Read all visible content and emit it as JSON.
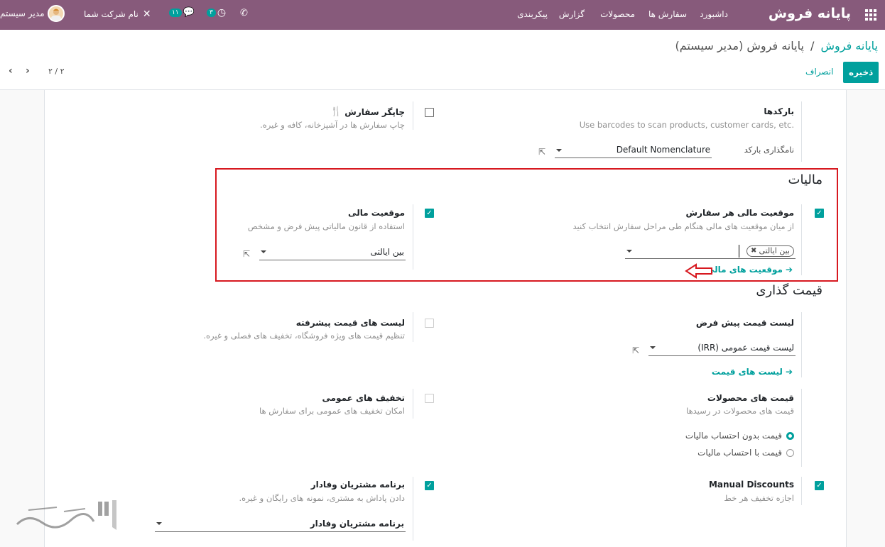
{
  "navbar": {
    "app_title": "پایانه فروش",
    "menu": [
      "داشبورد",
      "سفارش ها",
      "محصولات",
      "گزارش",
      "پیکربندی"
    ],
    "user_name": "مدیر سیستم",
    "company_name": "نام شرکت شما",
    "messages_count": "۱۱",
    "activities_count": "۳"
  },
  "control_panel": {
    "breadcrumb_root": "پایانه فروش",
    "breadcrumb_sep": "/",
    "breadcrumb_current": "پایانه فروش (مدیر سیستم)",
    "save_label": "ذخیره",
    "discard_label": "انصراف",
    "pager": "۲ / ۲"
  },
  "barcodes": {
    "title": "بارکدها",
    "desc": "Use barcodes to scan products, customer cards, etc.",
    "nomenclature_label": "نامگذاری بارکد",
    "nomenclature_value": "Default Nomenclature"
  },
  "order_printer": {
    "title": "چاپگر سفارش",
    "desc": "چاپ سفارش ها در آشپزخانه، کافه و غیره."
  },
  "taxes": {
    "section_title": "مالیات",
    "fp_per_order_title": "موقعیت مالی هر سفارش",
    "fp_per_order_desc": "از میان موقعیت های مالی هنگام طی مراحل سفارش انتخاب کنید",
    "fp_tag": "بین ایالتی",
    "fp_link": "موقعیت های مالی",
    "fp_title": "موقعیت مالی",
    "fp_desc": "استفاده از قانون مالیاتی پیش فرض و مشخص",
    "fp_value": "بین ایالتی"
  },
  "pricing": {
    "section_title": "قیمت گذاری",
    "default_pricelist_title": "لیست قیمت پیش فرض",
    "default_pricelist_value": "لیست قیمت عمومی (IRR)",
    "pricelists_link": "لیست های قیمت",
    "advanced_pricelists_title": "لیست های قیمت پیشرفته",
    "advanced_pricelists_desc": "تنظیم قیمت های ویژه فروشگاه، تخفیف های فصلی و غیره.",
    "product_prices_title": "قیمت های محصولات",
    "product_prices_desc": "قیمت های محصولات در رسیدها",
    "tax_excluded": "قیمت بدون احتساب مالیات",
    "tax_included": "قیمت با احتساب مالیات",
    "global_discounts_title": "تخفیف های عمومی",
    "global_discounts_desc": "امکان تخفیف های عمومی برای سفارش ها",
    "manual_discounts_title": "Manual Discounts",
    "manual_discounts_desc": "اجازه تخفیف هر خط",
    "loyalty_title": "برنامه مشتریان وفادار",
    "loyalty_desc": "دادن پاداش به مشتری، نمونه های رایگان و غیره.",
    "loyalty_value": "برنامه مشتریان وفادار"
  },
  "colors": {
    "navbar": "#875a7b",
    "accent": "#00a09d",
    "highlight": "#d71920"
  }
}
